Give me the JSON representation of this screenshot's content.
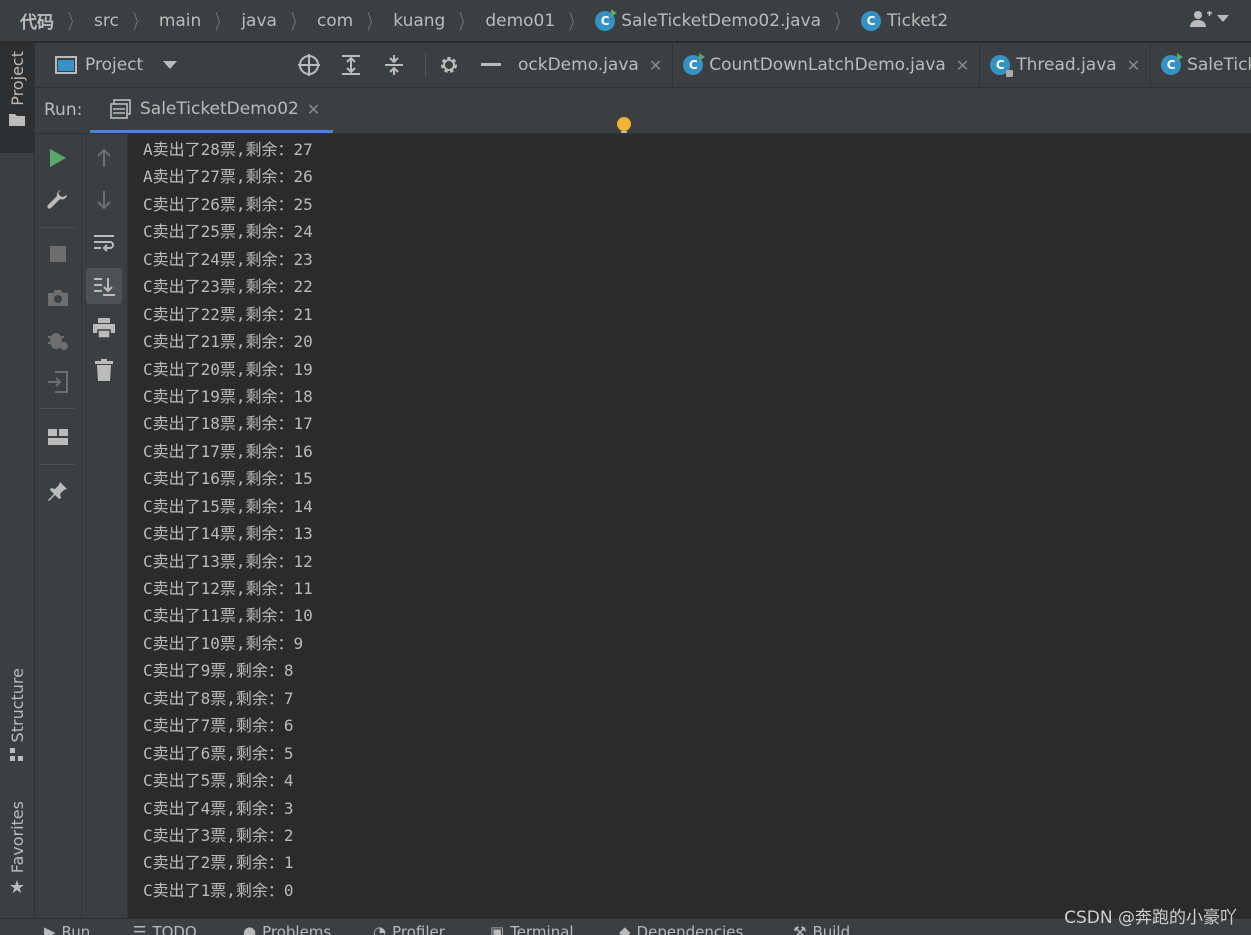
{
  "breadcrumb": {
    "items": [
      "代码",
      "src",
      "main",
      "java",
      "com",
      "kuang",
      "demo01",
      "SaleTicketDemo02.java",
      "Ticket2"
    ]
  },
  "left_stripe": {
    "project": "Project",
    "structure": "Structure",
    "favorites": "Favorites"
  },
  "project_toolbar": {
    "label": "Project"
  },
  "editor_tabs": [
    {
      "label": "ockDemo.java"
    },
    {
      "label": "CountDownLatchDemo.java"
    },
    {
      "label": "Thread.java"
    },
    {
      "label": "SaleTicket"
    }
  ],
  "run_panel": {
    "label": "Run:",
    "tab_label": "SaleTicketDemo02"
  },
  "console": {
    "lines": [
      "A卖出了28票,剩余：27",
      "A卖出了27票,剩余：26",
      "C卖出了26票,剩余：25",
      "C卖出了25票,剩余：24",
      "C卖出了24票,剩余：23",
      "C卖出了23票,剩余：22",
      "C卖出了22票,剩余：21",
      "C卖出了21票,剩余：20",
      "C卖出了20票,剩余：19",
      "C卖出了19票,剩余：18",
      "C卖出了18票,剩余：17",
      "C卖出了17票,剩余：16",
      "C卖出了16票,剩余：15",
      "C卖出了15票,剩余：14",
      "C卖出了14票,剩余：13",
      "C卖出了13票,剩余：12",
      "C卖出了12票,剩余：11",
      "C卖出了11票,剩余：10",
      "C卖出了10票,剩余：9",
      "C卖出了9票,剩余：8",
      "C卖出了8票,剩余：7",
      "C卖出了7票,剩余：6",
      "C卖出了6票,剩余：5",
      "C卖出了5票,剩余：4",
      "C卖出了4票,剩余：3",
      "C卖出了3票,剩余：2",
      "C卖出了2票,剩余：1",
      "C卖出了1票,剩余：0"
    ]
  },
  "bottom_bar": {
    "items": [
      "Run",
      "TODO",
      "Problems",
      "Profiler",
      "Terminal",
      "Dependencies",
      "Build"
    ]
  },
  "watermark": "CSDN @奔跑的小豪吖",
  "colors": {
    "accent": "#4a88c7",
    "class_icon": "#3592c4",
    "run_green": "#59a869",
    "bulb": "#f2b233"
  }
}
